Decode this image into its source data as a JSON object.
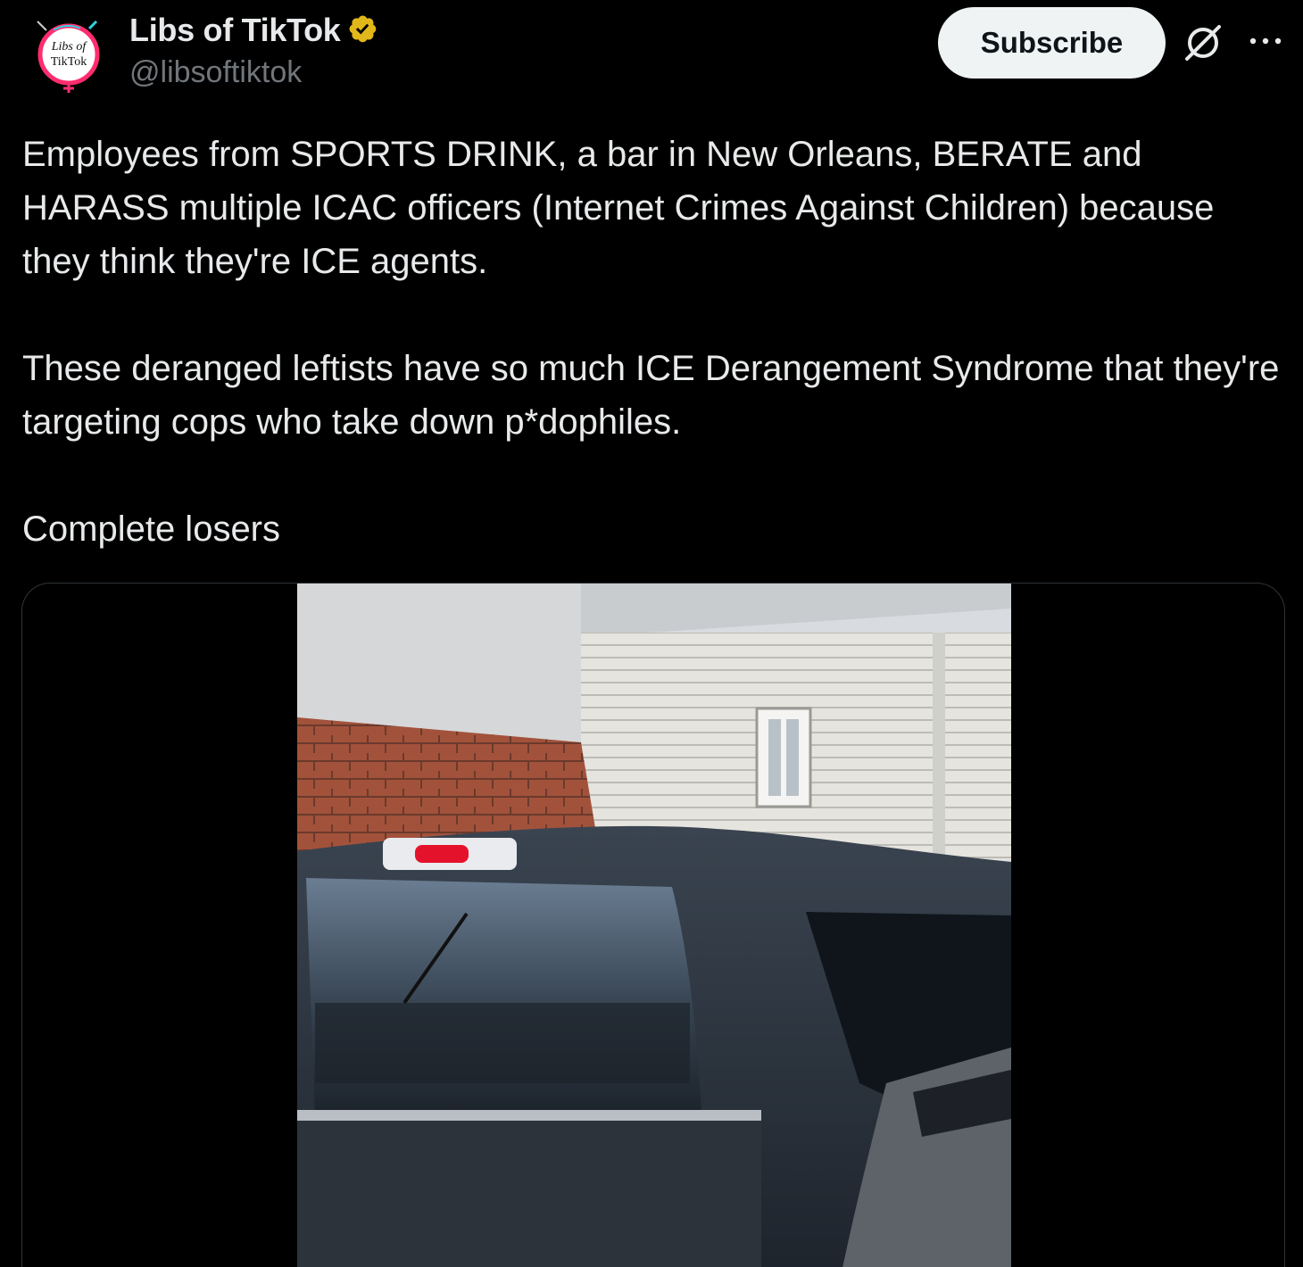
{
  "author": {
    "display_name": "Libs of TikTok",
    "handle": "@libsoftiktok",
    "verified": true,
    "verified_badge_color": "#e2b719",
    "avatar_logo_text": [
      "Libs of",
      "TikTok"
    ]
  },
  "actions": {
    "subscribe_label": "Subscribe",
    "grok_icon": "grok-icon",
    "more_icon": "more-options-icon"
  },
  "tweet": {
    "paragraphs": [
      "Employees from SPORTS DRINK, a bar in New Orleans, BERATE and HARASS multiple ICAC officers (Internet Crimes Against Children) because they think they're ICE agents.",
      "These deranged leftists have so much ICE Derangement Syndrome that they're targeting cops who take down p*dophiles.",
      "Complete losers"
    ]
  },
  "media": {
    "type": "video",
    "description_icon": "video-thumbnail"
  },
  "colors": {
    "background": "#000000",
    "text_primary": "#e7e9ea",
    "text_secondary": "#71767b",
    "button_bg": "#eff3f4",
    "button_text": "#0f1419",
    "border": "#2f3336"
  }
}
